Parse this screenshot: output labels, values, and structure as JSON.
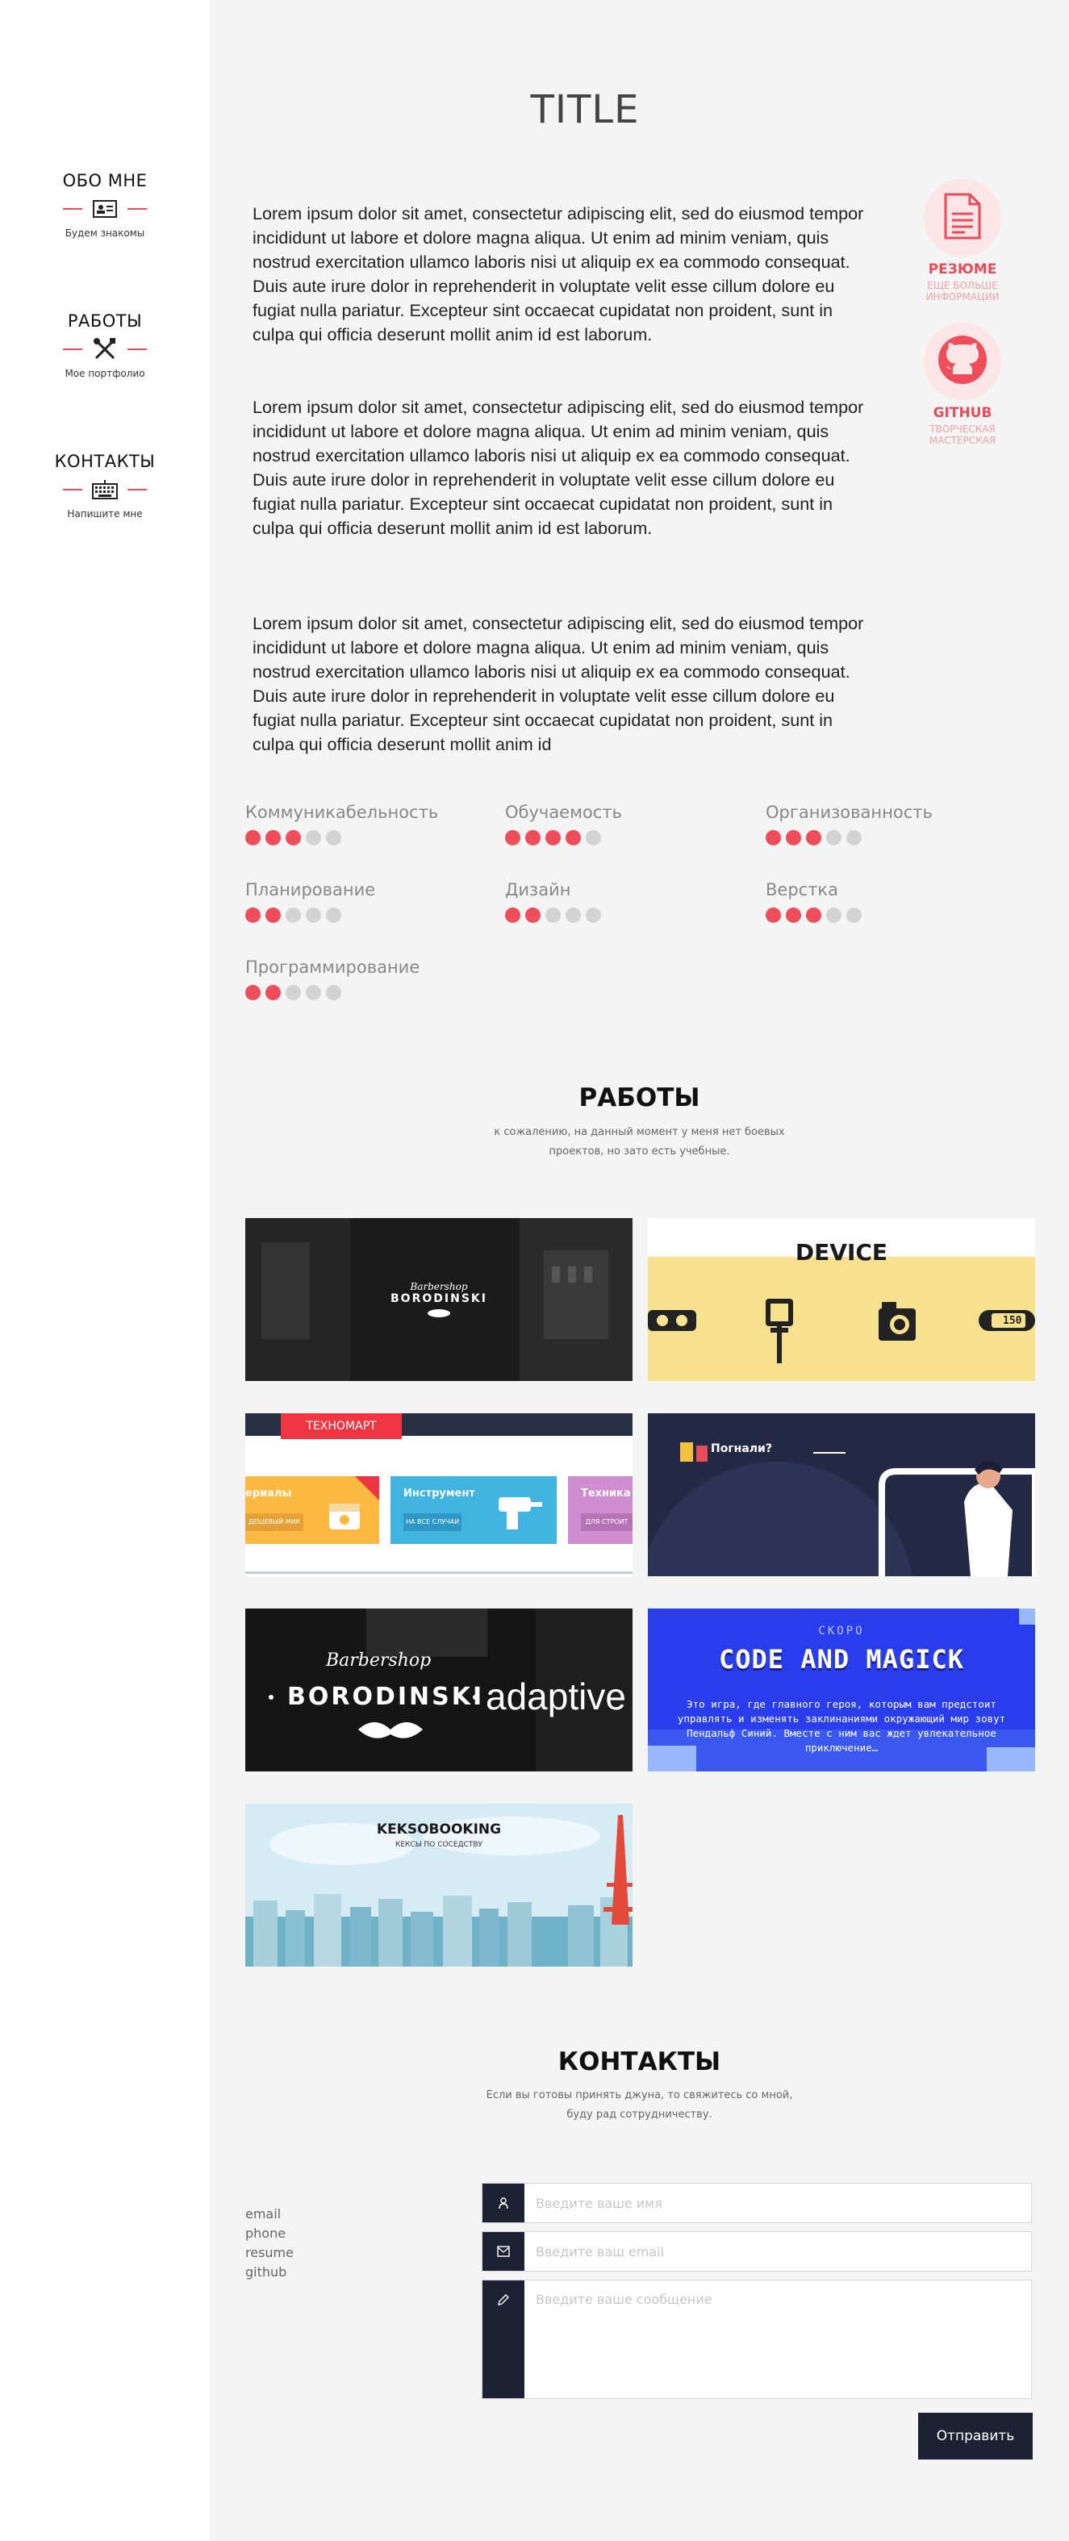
{
  "sidebar": {
    "items": [
      {
        "title": "ОБО МНЕ",
        "sub": "Будем знакомы",
        "icon": "id-card-icon"
      },
      {
        "title": "РАБОТЫ",
        "sub": "Мое портфолио",
        "icon": "tools-icon"
      },
      {
        "title": "КОНТАКТЫ",
        "sub": "Напишите мне",
        "icon": "keyboard-icon"
      }
    ]
  },
  "about": {
    "title": "TITLE",
    "paragraphs": [
      "Lorem ipsum dolor sit amet, consectetur adipiscing elit, sed do eiusmod tempor incididunt ut labore et dolore magna aliqua. Ut enim ad minim veniam, quis nostrud exercitation ullamco laboris nisi ut aliquip ex ea commodo consequat. Duis aute irure dolor in reprehenderit in voluptate velit esse cillum dolore eu fugiat nulla pariatur. Excepteur sint occaecat cupidatat non proident, sunt in culpa qui officia deserunt mollit anim id est laborum.",
      "Lorem ipsum dolor sit amet, consectetur adipiscing elit, sed do eiusmod tempor incididunt ut labore et dolore magna aliqua. Ut enim ad minim veniam, quis nostrud exercitation ullamco laboris nisi ut aliquip ex ea commodo consequat. Duis aute irure dolor in reprehenderit in voluptate velit esse cillum dolore eu fugiat nulla pariatur. Excepteur sint occaecat cupidatat non proident, sunt in culpa qui officia deserunt mollit anim id est laborum.",
      "Lorem ipsum dolor sit amet, consectetur adipiscing elit, sed do eiusmod tempor incididunt ut labore et dolore magna aliqua. Ut enim ad minim veniam, quis nostrud exercitation ullamco laboris nisi ut aliquip ex ea commodo consequat. Duis aute irure dolor in reprehenderit in voluptate velit esse cillum dolore eu fugiat nulla pariatur. Excepteur sint occaecat cupidatat non proident, sunt in culpa qui officia deserunt mollit anim id"
    ],
    "links": [
      {
        "title": "РЕЗЮМЕ",
        "sub": "ЕЩЕ БОЛЬШЕ ИНФОРМАЦИИ",
        "icon": "document-icon"
      },
      {
        "title": "GITHUB",
        "sub": "ТВОРЧЕСКАЯ МАСТЕРСКАЯ",
        "icon": "github-icon"
      }
    ]
  },
  "skills": [
    {
      "name": "Коммуникабельность",
      "level": 3,
      "max": 5
    },
    {
      "name": "Обучаемость",
      "level": 4,
      "max": 5
    },
    {
      "name": "Организованность",
      "level": 3,
      "max": 5
    },
    {
      "name": "Планирование",
      "level": 2,
      "max": 5
    },
    {
      "name": "Дизайн",
      "level": 2,
      "max": 5
    },
    {
      "name": "Верстка",
      "level": 3,
      "max": 5
    },
    {
      "name": "Программирование",
      "level": 2,
      "max": 5
    }
  ],
  "works": {
    "title": "РАБОТЫ",
    "subtitle_1": "к сожалению, на данный момент у меня нет боевых",
    "subtitle_2": "проектов, но зато есть учебные.",
    "projects": {
      "barbershop": {
        "script": "Barbershop",
        "name": "BORODINSKI"
      },
      "device": {
        "name": "DEVICE",
        "badge": "150"
      },
      "technomart": {
        "brand": "ТЕХНОМАРТ",
        "cards": [
          "ериалы",
          "Инструмент",
          "Техника"
        ],
        "buttons": [
          "ДЕШЕВЫЙ МИК",
          "НА ВСЕ СЛУЧАИ",
          "ДЛЯ СТРОИТ"
        ]
      },
      "pognali": {
        "name": "Погнали?"
      },
      "barbershop_adaptive": {
        "script": "Barbershop",
        "name": "BORODINSKI",
        "suffix": "adaptive"
      },
      "code_magick": {
        "soon": "СКОРО",
        "name": "CODE AND MAGICK",
        "text": "Это игра, где главного героя, которым вам предстоит управлять и изменять заклинаниями окружающий мир зовут Пендальф Синий. Вместе с ним вас ждет увлекательное приключение…"
      },
      "keksobooking": {
        "name": "KEKSOBOOKING",
        "sub": "КЕКСЫ ПО СОСЕДСТВУ"
      }
    }
  },
  "contacts": {
    "title": "КОНТАКТЫ",
    "subtitle_1": "Если вы готовы принять джуна, то свяжитесь со мной,",
    "subtitle_2": "буду рад сотрудничеству.",
    "links": [
      "email",
      "phone",
      "resume",
      "github"
    ],
    "form": {
      "name_placeholder": "Введите ваше имя",
      "email_placeholder": "Введите ваш email",
      "message_placeholder": "Введите ваше сообщение",
      "submit_label": "Отправить"
    }
  },
  "colors": {
    "accent": "#f04d5b",
    "dark": "#1c2233",
    "dot_off": "#d3d3d3"
  }
}
